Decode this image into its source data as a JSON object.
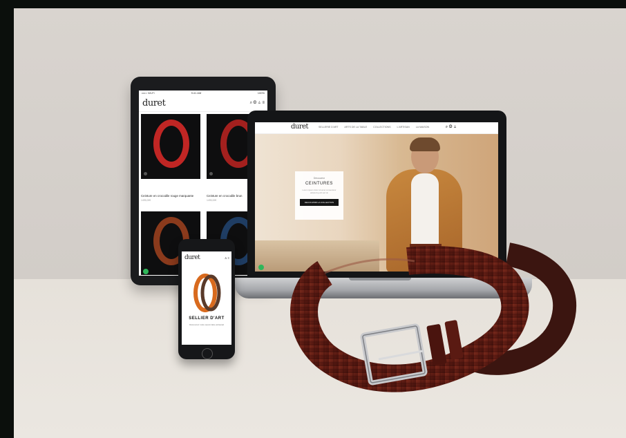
{
  "brand": {
    "logo_text": "duret"
  },
  "tablet": {
    "status_left": "••••○ Wi-Fi",
    "status_time": "9:41 AM",
    "status_right": "100%",
    "icons": "⌕ ◍ ♙ ≡",
    "products": [
      {
        "name": "Ceinture en crocodile rouge marquante",
        "price": "1495,00€"
      },
      {
        "name": "Ceinture en crocodile brun",
        "price": "1495,00€"
      }
    ]
  },
  "laptop": {
    "menu": [
      "SELLERIE D'ART",
      "ARTS DE LA TABLE",
      "COLLECTIONS",
      "L'ARTISAN",
      "LA MAISON"
    ],
    "icons": "⌕ ◍ ♙",
    "hero": {
      "pretitle": "Découvrez",
      "title": "CEINTURES",
      "text": "Lorem ipsum dolor sit amet consectetur adipiscing elit sed do",
      "button": "DECOUVRIR LA COLLECTION"
    }
  },
  "phone": {
    "icons": "♙ ≡",
    "title": "SELLIER D'ART",
    "text": "Découvrez notre savoir-faire artisanal"
  },
  "colors": {
    "wall": "#d6d1cc",
    "table": "#e9e4de",
    "device_frame": "#1b1c1e",
    "belt_leather": "#5a1a12",
    "accent_green": "#2fb65a"
  }
}
